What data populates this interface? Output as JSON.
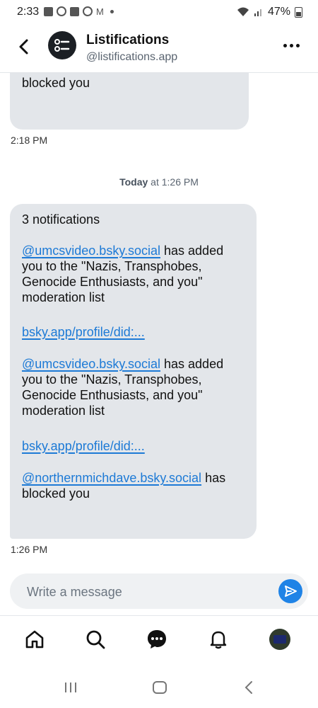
{
  "status_bar": {
    "time": "2:33",
    "battery": "47%"
  },
  "header": {
    "title": "Listifications",
    "handle": "@listifications.app"
  },
  "messages": {
    "old_bubble_text": "blocked you",
    "old_time": "2:18 PM",
    "divider": {
      "day": "Today",
      "rest": " at 1:26 PM"
    },
    "new_bubble": {
      "count": "3 notifications",
      "n1_handle": "@umcsvideo.bsky.social",
      "n1_text1": " has added",
      "n1_text2": "you to the \"Nazis, Transphobes,",
      "n1_text3": "Genocide Enthusiasts, and you\"",
      "n1_text4": "moderation list",
      "link1": "bsky.app/profile/did:...",
      "n2_handle": "@umcsvideo.bsky.social",
      "n2_text1": " has added",
      "n2_text2": "you to the \"Nazis, Transphobes,",
      "n2_text3": "Genocide Enthusiasts, and you\"",
      "n2_text4": "moderation list",
      "link2": "bsky.app/profile/did:...",
      "n3_handle": "@northernmichdave.bsky.social",
      "n3_text1": " has",
      "n3_text2": "blocked you"
    },
    "new_time": "1:26 PM"
  },
  "composer": {
    "placeholder": "Write a message"
  },
  "colors": {
    "accent": "#1f83e6",
    "bubble": "#e3e6ea",
    "link": "#1d7ad6"
  }
}
